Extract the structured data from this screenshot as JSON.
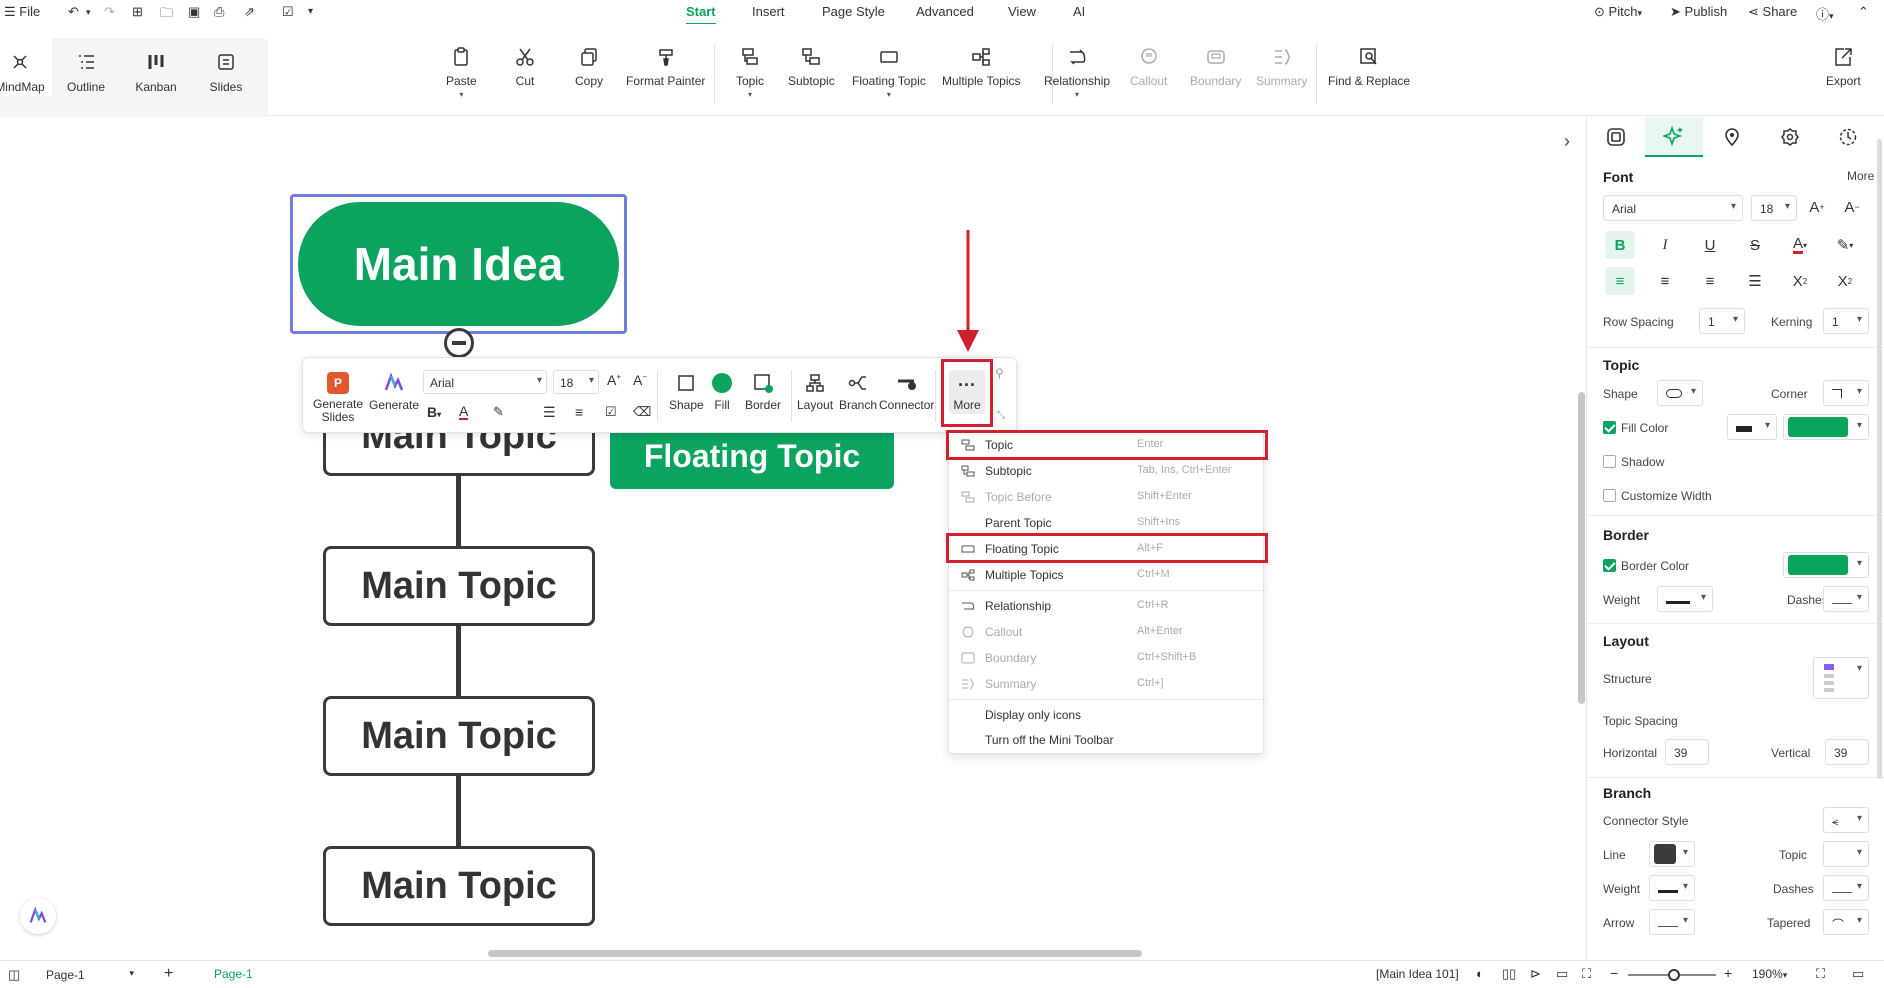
{
  "menubar": {
    "file": "File",
    "tabs": [
      "Start",
      "Insert",
      "Page Style",
      "Advanced",
      "View",
      "AI"
    ],
    "active_tab": "Start",
    "pitch": "Pitch",
    "publish": "Publish",
    "share": "Share"
  },
  "ribbon": {
    "views": [
      "MindMap",
      "Outline",
      "Kanban",
      "Slides"
    ],
    "items": [
      "Paste",
      "Cut",
      "Copy",
      "Format Painter",
      "Topic",
      "Subtopic",
      "Floating Topic",
      "Multiple Topics",
      "Relationship",
      "Callout",
      "Boundary",
      "Summary",
      "Find & Replace",
      "Export"
    ],
    "disabled_items": [
      "Callout",
      "Boundary",
      "Summary"
    ]
  },
  "canvas": {
    "main_idea": "Main Idea",
    "topics": [
      "Main Topic",
      "Main Topic",
      "Main Topic",
      "Main Topic"
    ],
    "floating_topic": "Floating Topic"
  },
  "mini_toolbar": {
    "generate_slides": "Generate Slides",
    "generate": "Generate",
    "font": "Arial",
    "font_size": "18",
    "shape": "Shape",
    "fill": "Fill",
    "border": "Border",
    "layout": "Layout",
    "branch": "Branch",
    "connector": "Connector",
    "more": "More"
  },
  "context_menu": {
    "items": [
      {
        "label": "Topic",
        "shortcut": "Enter",
        "disabled": false
      },
      {
        "label": "Subtopic",
        "shortcut": "Tab, Ins, Ctrl+Enter",
        "disabled": false
      },
      {
        "label": "Topic Before",
        "shortcut": "Shift+Enter",
        "disabled": true
      },
      {
        "label": "Parent Topic",
        "shortcut": "Shift+Ins",
        "disabled": false
      },
      {
        "label": "Floating Topic",
        "shortcut": "Alt+F",
        "disabled": false
      },
      {
        "label": "Multiple Topics",
        "shortcut": "Ctrl+M",
        "disabled": false
      },
      {
        "label": "Relationship",
        "shortcut": "Ctrl+R",
        "disabled": false
      },
      {
        "label": "Callout",
        "shortcut": "Alt+Enter",
        "disabled": true
      },
      {
        "label": "Boundary",
        "shortcut": "Ctrl+Shift+B",
        "disabled": true
      },
      {
        "label": "Summary",
        "shortcut": "Ctrl+]",
        "disabled": true
      },
      {
        "label": "Display only icons",
        "shortcut": "",
        "disabled": false
      },
      {
        "label": "Turn off the Mini Toolbar",
        "shortcut": "",
        "disabled": false
      }
    ]
  },
  "panel": {
    "font": {
      "heading": "Font",
      "more": "More",
      "family": "Arial",
      "size": "18",
      "row_spacing_label": "Row Spacing",
      "row_spacing": "1",
      "kerning_label": "Kerning",
      "kerning": "1"
    },
    "topic": {
      "heading": "Topic",
      "shape_label": "Shape",
      "corner_label": "Corner",
      "fill_color": "Fill Color",
      "shadow": "Shadow",
      "customize_width": "Customize Width"
    },
    "border": {
      "heading": "Border",
      "border_color": "Border Color",
      "weight": "Weight",
      "dashes": "Dashes"
    },
    "layout": {
      "heading": "Layout",
      "structure": "Structure",
      "topic_spacing": "Topic Spacing",
      "horizontal_label": "Horizontal",
      "horizontal": "39",
      "vertical_label": "Vertical",
      "vertical": "39"
    },
    "branch": {
      "heading": "Branch",
      "connector_style": "Connector Style",
      "line": "Line",
      "topic": "Topic",
      "weight": "Weight",
      "dashes": "Dashes",
      "arrow": "Arrow",
      "tapered": "Tapered"
    }
  },
  "statusbar": {
    "page_select": "Page-1",
    "page_tab": "Page-1",
    "selection": "[Main Idea 101]",
    "zoom": "190%"
  },
  "colors": {
    "accent": "#0aa45f",
    "highlight": "#d3202e",
    "selection": "#6b7ee0"
  }
}
